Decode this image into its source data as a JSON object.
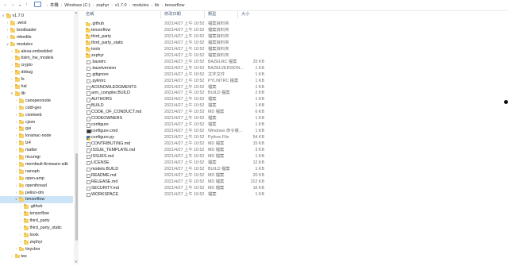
{
  "nav": {
    "back_icon": "arrow-left-icon",
    "forward_icon": "arrow-right-icon",
    "recent_icon": "chevron-down-icon",
    "up_icon": "arrow-up-icon"
  },
  "breadcrumb": [
    "本機",
    "Windows (C:)",
    "zephyr",
    "v1.7.0",
    "modules",
    "lib",
    "tensorflow"
  ],
  "sidebar": {
    "items": [
      {
        "label": "v1.7.0",
        "indent": 1,
        "expanded": true
      },
      {
        "label": ".west",
        "indent": 2
      },
      {
        "label": "bootloader",
        "indent": 2
      },
      {
        "label": "mbedtls",
        "indent": 2
      },
      {
        "label": "modules",
        "indent": 2,
        "expanded": true
      },
      {
        "label": "alexa-embedded",
        "indent": 3
      },
      {
        "label": "bsim_hw_models",
        "indent": 3
      },
      {
        "label": "crypto",
        "indent": 3
      },
      {
        "label": "debug",
        "indent": 3
      },
      {
        "label": "fs",
        "indent": 3
      },
      {
        "label": "hal",
        "indent": 3
      },
      {
        "label": "lib",
        "indent": 3,
        "expanded": true
      },
      {
        "label": "canopennode",
        "indent": 4
      },
      {
        "label": "cddl-gen",
        "indent": 4
      },
      {
        "label": "civetweb",
        "indent": 4
      },
      {
        "label": "cjson",
        "indent": 4
      },
      {
        "label": "gui",
        "indent": 4
      },
      {
        "label": "loramac-node",
        "indent": 4
      },
      {
        "label": "lz4",
        "indent": 4
      },
      {
        "label": "matter",
        "indent": 4
      },
      {
        "label": "mcumgr",
        "indent": 4
      },
      {
        "label": "memfault-firmware-sdk",
        "indent": 4
      },
      {
        "label": "nanopb",
        "indent": 4
      },
      {
        "label": "open-amp",
        "indent": 4
      },
      {
        "label": "openthread",
        "indent": 4
      },
      {
        "label": "pelion-dm",
        "indent": 4
      },
      {
        "label": "tensorflow",
        "indent": 4,
        "selected": true,
        "expanded": true
      },
      {
        "label": ".github",
        "indent": 5
      },
      {
        "label": "tensorflow",
        "indent": 5
      },
      {
        "label": "third_party",
        "indent": 5
      },
      {
        "label": "third_party_static",
        "indent": 5
      },
      {
        "label": "tools",
        "indent": 5
      },
      {
        "label": "zephyr",
        "indent": 5
      },
      {
        "label": "tinycbor",
        "indent": 4
      },
      {
        "label": "tee",
        "indent": 3
      }
    ]
  },
  "columns": {
    "name": "名稱",
    "date": "修改日期",
    "type": "類型",
    "size": "大小"
  },
  "files": [
    {
      "name": ".github",
      "date": "2021/4/27 上午 10:52",
      "type": "檔案資料夾",
      "size": "",
      "icon": "folder"
    },
    {
      "name": "tensorflow",
      "date": "2021/4/27 上午 10:52",
      "type": "檔案資料夾",
      "size": "",
      "icon": "folder"
    },
    {
      "name": "third_party",
      "date": "2021/4/27 上午 10:52",
      "type": "檔案資料夾",
      "size": "",
      "icon": "folder"
    },
    {
      "name": "third_party_static",
      "date": "2021/4/27 上午 10:52",
      "type": "檔案資料夾",
      "size": "",
      "icon": "folder"
    },
    {
      "name": "tools",
      "date": "2021/4/27 上午 10:52",
      "type": "檔案資料夾",
      "size": "",
      "icon": "folder"
    },
    {
      "name": "zephyr",
      "date": "2021/4/27 上午 10:52",
      "type": "檔案資料夾",
      "size": "",
      "icon": "folder"
    },
    {
      "name": ".bazelrc",
      "date": "2021/4/27 上午 10:52",
      "type": "BAZELRC 檔案",
      "size": "33 KB",
      "icon": "doc"
    },
    {
      "name": ".bazelversion",
      "date": "2021/4/27 上午 10:52",
      "type": "BAZELVERSION...",
      "size": "1 KB",
      "icon": "doc"
    },
    {
      "name": ".gitignore",
      "date": "2021/4/27 上午 10:52",
      "type": "文字文件",
      "size": "1 KB",
      "icon": "doc"
    },
    {
      "name": ".pylintrc",
      "date": "2021/4/27 上午 10:52",
      "type": "PYLINTRC 檔案",
      "size": "1 KB",
      "icon": "doc"
    },
    {
      "name": "ACKNOWLEDGMENTS",
      "date": "2021/4/27 上午 10:52",
      "type": "檔案",
      "size": "1 KB",
      "icon": "doc"
    },
    {
      "name": "arm_compiler.BUILD",
      "date": "2021/4/27 上午 10:52",
      "type": "BUILD 檔案",
      "size": "2 KB",
      "icon": "doc"
    },
    {
      "name": "AUTHORS",
      "date": "2021/4/27 上午 10:52",
      "type": "檔案",
      "size": "1 KB",
      "icon": "doc"
    },
    {
      "name": "BUILD",
      "date": "2021/4/27 上午 10:52",
      "type": "檔案",
      "size": "1 KB",
      "icon": "doc"
    },
    {
      "name": "CODE_OF_CONDUCT.md",
      "date": "2021/4/27 上午 10:52",
      "type": "MD 檔案",
      "size": "6 KB",
      "icon": "doc"
    },
    {
      "name": "CODEOWNERS",
      "date": "2021/4/27 上午 10:52",
      "type": "檔案",
      "size": "1 KB",
      "icon": "doc"
    },
    {
      "name": "configure",
      "date": "2021/4/27 上午 10:52",
      "type": "檔案",
      "size": "1 KB",
      "icon": "doc"
    },
    {
      "name": "configure.cmd",
      "date": "2021/4/27 上午 10:52",
      "type": "Windows 命令複...",
      "size": "1 KB",
      "icon": "cmd"
    },
    {
      "name": "configure.py",
      "date": "2021/4/27 上午 10:52",
      "type": "Python File",
      "size": "54 KB",
      "icon": "python"
    },
    {
      "name": "CONTRIBUTING.md",
      "date": "2021/4/27 上午 10:52",
      "type": "MD 檔案",
      "size": "15 KB",
      "icon": "doc"
    },
    {
      "name": "ISSUE_TEMPLATE.md",
      "date": "2021/4/27 上午 10:52",
      "type": "MD 檔案",
      "size": "3 KB",
      "icon": "doc"
    },
    {
      "name": "ISSUES.md",
      "date": "2021/4/27 上午 10:52",
      "type": "MD 檔案",
      "size": "1 KB",
      "icon": "doc"
    },
    {
      "name": "LICENSE",
      "date": "2021/4/27 上午 10:52",
      "type": "檔案",
      "size": "12 KB",
      "icon": "doc"
    },
    {
      "name": "models.BUILD",
      "date": "2021/4/27 上午 10:52",
      "type": "BUILD 檔案",
      "size": "1 KB",
      "icon": "doc"
    },
    {
      "name": "README.md",
      "date": "2021/4/27 上午 10:52",
      "type": "MD 檔案",
      "size": "20 KB",
      "icon": "doc"
    },
    {
      "name": "RELEASE.md",
      "date": "2021/4/27 上午 10:52",
      "type": "MD 檔案",
      "size": "312 KB",
      "icon": "doc"
    },
    {
      "name": "SECURITY.md",
      "date": "2021/4/27 上午 10:52",
      "type": "MD 檔案",
      "size": "16 KB",
      "icon": "doc"
    },
    {
      "name": "WORKSPACE",
      "date": "2021/4/27 上午 10:52",
      "type": "檔案",
      "size": "1 KB",
      "icon": "doc"
    }
  ],
  "colors": {
    "folder": "#f4cf62",
    "selection": "#cce4f7",
    "header_text": "#4c607a"
  }
}
